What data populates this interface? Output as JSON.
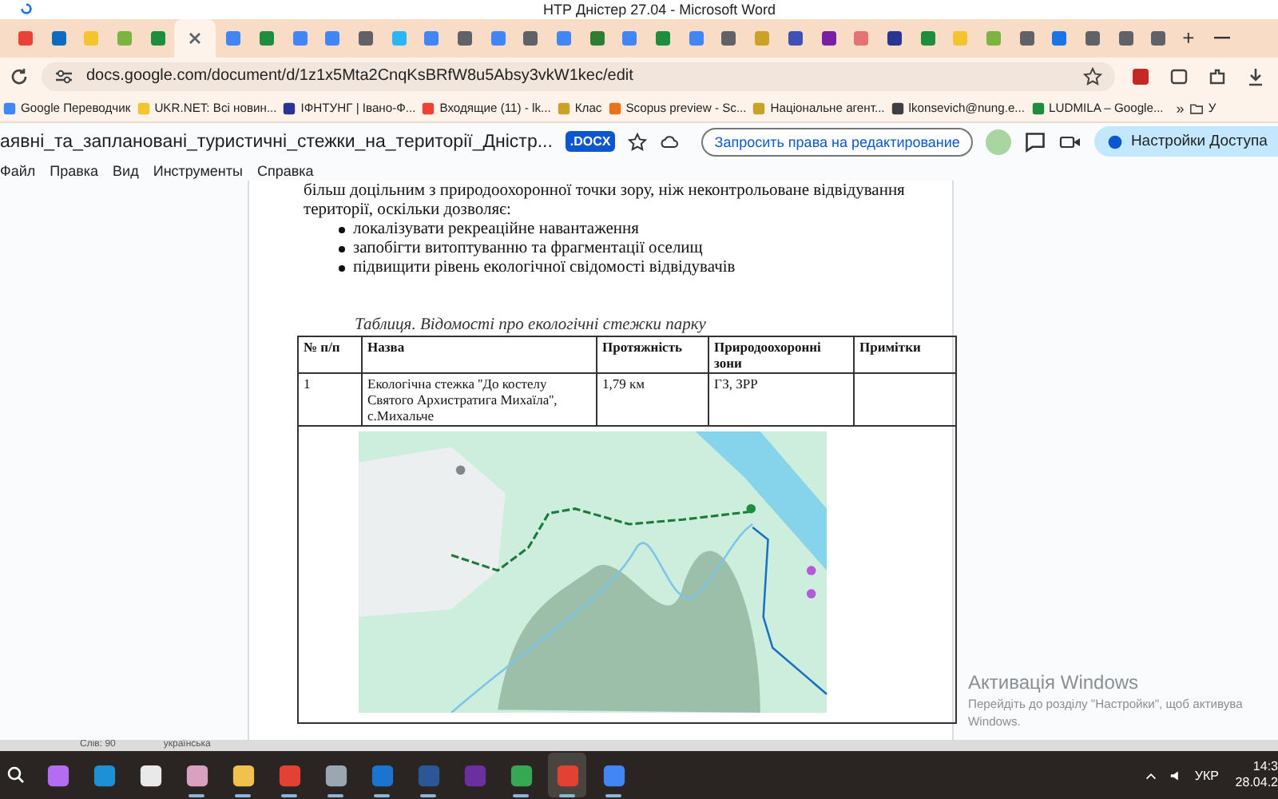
{
  "word_title": "НТР Дністер 27.04 - Microsoft Word",
  "tabs": [
    {
      "color": "#ea4335",
      "selected": false
    },
    {
      "color": "#0f6cbd",
      "selected": false
    },
    {
      "color": "#f4c430",
      "selected": false
    },
    {
      "color": "#7cb342",
      "selected": false
    },
    {
      "color": "#1e8e3e",
      "selected": false
    },
    {
      "color": "#5f6368",
      "selected": true
    },
    {
      "color": "#4285f4",
      "selected": false
    },
    {
      "color": "#1e8e3e",
      "selected": false
    },
    {
      "color": "#4285f4",
      "selected": false
    },
    {
      "color": "#4285f4",
      "selected": false
    },
    {
      "color": "#5f6368",
      "selected": false
    },
    {
      "color": "#29b6f6",
      "selected": false
    },
    {
      "color": "#4285f4",
      "selected": false
    },
    {
      "color": "#5f6368",
      "selected": false
    },
    {
      "color": "#4285f4",
      "selected": false
    },
    {
      "color": "#5f6368",
      "selected": false
    },
    {
      "color": "#4285f4",
      "selected": false
    },
    {
      "color": "#2e7d32",
      "selected": false
    },
    {
      "color": "#4285f4",
      "selected": false
    },
    {
      "color": "#1e8e3e",
      "selected": false
    },
    {
      "color": "#4285f4",
      "selected": false
    },
    {
      "color": "#5f6368",
      "selected": false
    },
    {
      "color": "#c9a227",
      "selected": false
    },
    {
      "color": "#3f51b5",
      "selected": false
    },
    {
      "color": "#7b1fa2",
      "selected": false
    },
    {
      "color": "#e57373",
      "selected": false
    },
    {
      "color": "#283593",
      "selected": false
    },
    {
      "color": "#1e8e3e",
      "selected": false
    },
    {
      "color": "#f4c430",
      "selected": false
    },
    {
      "color": "#7cb342",
      "selected": false
    },
    {
      "color": "#5f6368",
      "selected": false
    },
    {
      "color": "#1a73e8",
      "selected": false
    },
    {
      "color": "#5f6368",
      "selected": false
    },
    {
      "color": "#5f6368",
      "selected": false
    },
    {
      "color": "#5f6368",
      "selected": false
    }
  ],
  "new_tab": "+",
  "address": {
    "url": "docs.google.com/document/d/1z1x5Mta2CnqKsBRfW8u5Absy3vkW1kec/edit"
  },
  "bookmarks": [
    {
      "label": "Google Переводчик",
      "color": "#4285f4"
    },
    {
      "label": "UKR.NET: Всі новин...",
      "color": "#f4c430"
    },
    {
      "label": "ІФНТУНГ | Івано-Ф...",
      "color": "#283593"
    },
    {
      "label": "Входящие (11) - lk...",
      "color": "#ea4335"
    },
    {
      "label": "Клас",
      "color": "#c9a227"
    },
    {
      "label": "Scopus preview - Sc...",
      "color": "#e8711c"
    },
    {
      "label": "Національне агент...",
      "color": "#c9a227"
    },
    {
      "label": "lkonsevich@nung.e...",
      "color": "#3c4043"
    },
    {
      "label": "LUDMILA – Google...",
      "color": "#1e8e3e"
    }
  ],
  "bookmarks_more": "»",
  "bookmark_folder": "У",
  "doc_header": {
    "title": "аявні_та_заплановані_туристичні_стежки_на_території_Дністр...",
    "badge": ".DOCX",
    "request_button": "Запросить права на редактирование",
    "share_button": "Настройки Доступа"
  },
  "menu": [
    "Файл",
    "Правка",
    "Вид",
    "Инструменты",
    "Справка"
  ],
  "document": {
    "intro_lines": [
      "більш доцільним з природоохоронної точки зору, ніж неконтрольоване відвідування",
      "території, оскільки дозволяє:"
    ],
    "bullets": [
      "локалізувати рекреаційне навантаження",
      "запобігти витоптуванню та фрагментації оселищ",
      "підвищити рівень екологічної свідомості відвідувачів"
    ],
    "table_caption": "Таблиця. Відомості про екологічні стежки парку",
    "table": {
      "columns": [
        "№ п/п",
        "Назва",
        "Протяжність",
        "Природоохоронні зони",
        "Примітки"
      ],
      "rows": [
        [
          "1",
          "Екологічна стежка ''До костелу Святого Архистратига Михаїла'', с.Михальче",
          "1,79 км",
          "ГЗ, ЗРР",
          ""
        ]
      ]
    }
  },
  "status_bar": {
    "words": "Слів: 90",
    "language": "українська"
  },
  "taskbar": {
    "apps": [
      {
        "color": "#b46cf0",
        "running": false,
        "selected": false
      },
      {
        "color": "#1e90d6",
        "running": false,
        "selected": false
      },
      {
        "color": "#e9e9e9",
        "running": false,
        "selected": false
      },
      {
        "color": "#d9a0c0",
        "running": true,
        "selected": false
      },
      {
        "color": "#f2c04c",
        "running": true,
        "selected": false
      },
      {
        "color": "#e34133",
        "running": true,
        "selected": false
      },
      {
        "color": "#9aa7b0",
        "running": true,
        "selected": false
      },
      {
        "color": "#1b74d0",
        "running": true,
        "selected": false
      },
      {
        "color": "#2b5797",
        "running": true,
        "selected": false
      },
      {
        "color": "#6b2fa0",
        "running": false,
        "selected": false
      },
      {
        "color": "#34a853",
        "running": true,
        "selected": false
      },
      {
        "color": "#e34133",
        "running": true,
        "selected": true
      },
      {
        "color": "#4285f4",
        "running": true,
        "selected": false
      }
    ],
    "language": "УКР",
    "time": "14:3",
    "date": "28.04.2"
  },
  "activation": {
    "title": "Активація Windows",
    "message": "Перейдіть до розділу \"Настройки\", щоб активува",
    "message_2": "Windows."
  }
}
